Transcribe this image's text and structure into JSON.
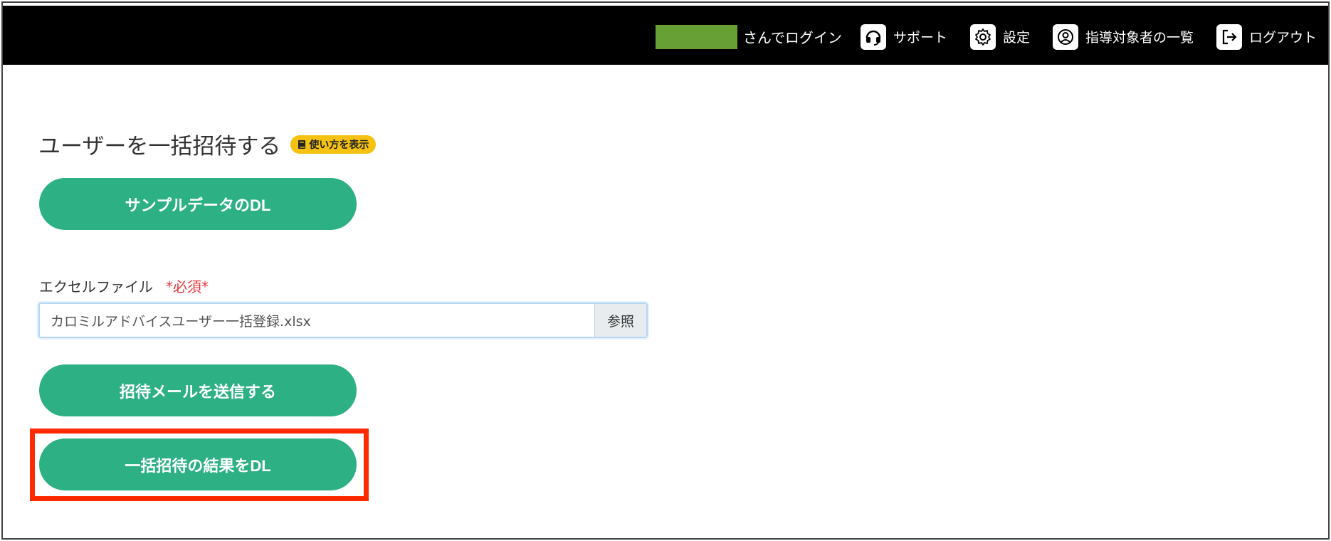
{
  "header": {
    "user_color": "#67a136",
    "login_text": "さんでログイン",
    "nav": [
      {
        "label": "サポート",
        "icon": "headset-icon"
      },
      {
        "label": "設定",
        "icon": "gear-icon"
      },
      {
        "label": "指導対象者の一覧",
        "icon": "user-circle-icon"
      },
      {
        "label": "ログアウト",
        "icon": "logout-icon"
      }
    ]
  },
  "main": {
    "title": "ユーザーを一括招待する",
    "help_badge": "使い方を表示",
    "sample_button": "サンプルデータのDL",
    "file_label": "エクセルファイル",
    "required_mark": "*必須*",
    "file_value": "カロミルアドバイスユーザー一括登録.xlsx",
    "browse_label": "参照",
    "send_button": "招待メールを送信する",
    "result_button": "一括招待の結果をDL"
  },
  "colors": {
    "accent": "#2db084",
    "highlight": "#ff2a00",
    "badge": "#f5c211",
    "required": "#e0393e"
  }
}
